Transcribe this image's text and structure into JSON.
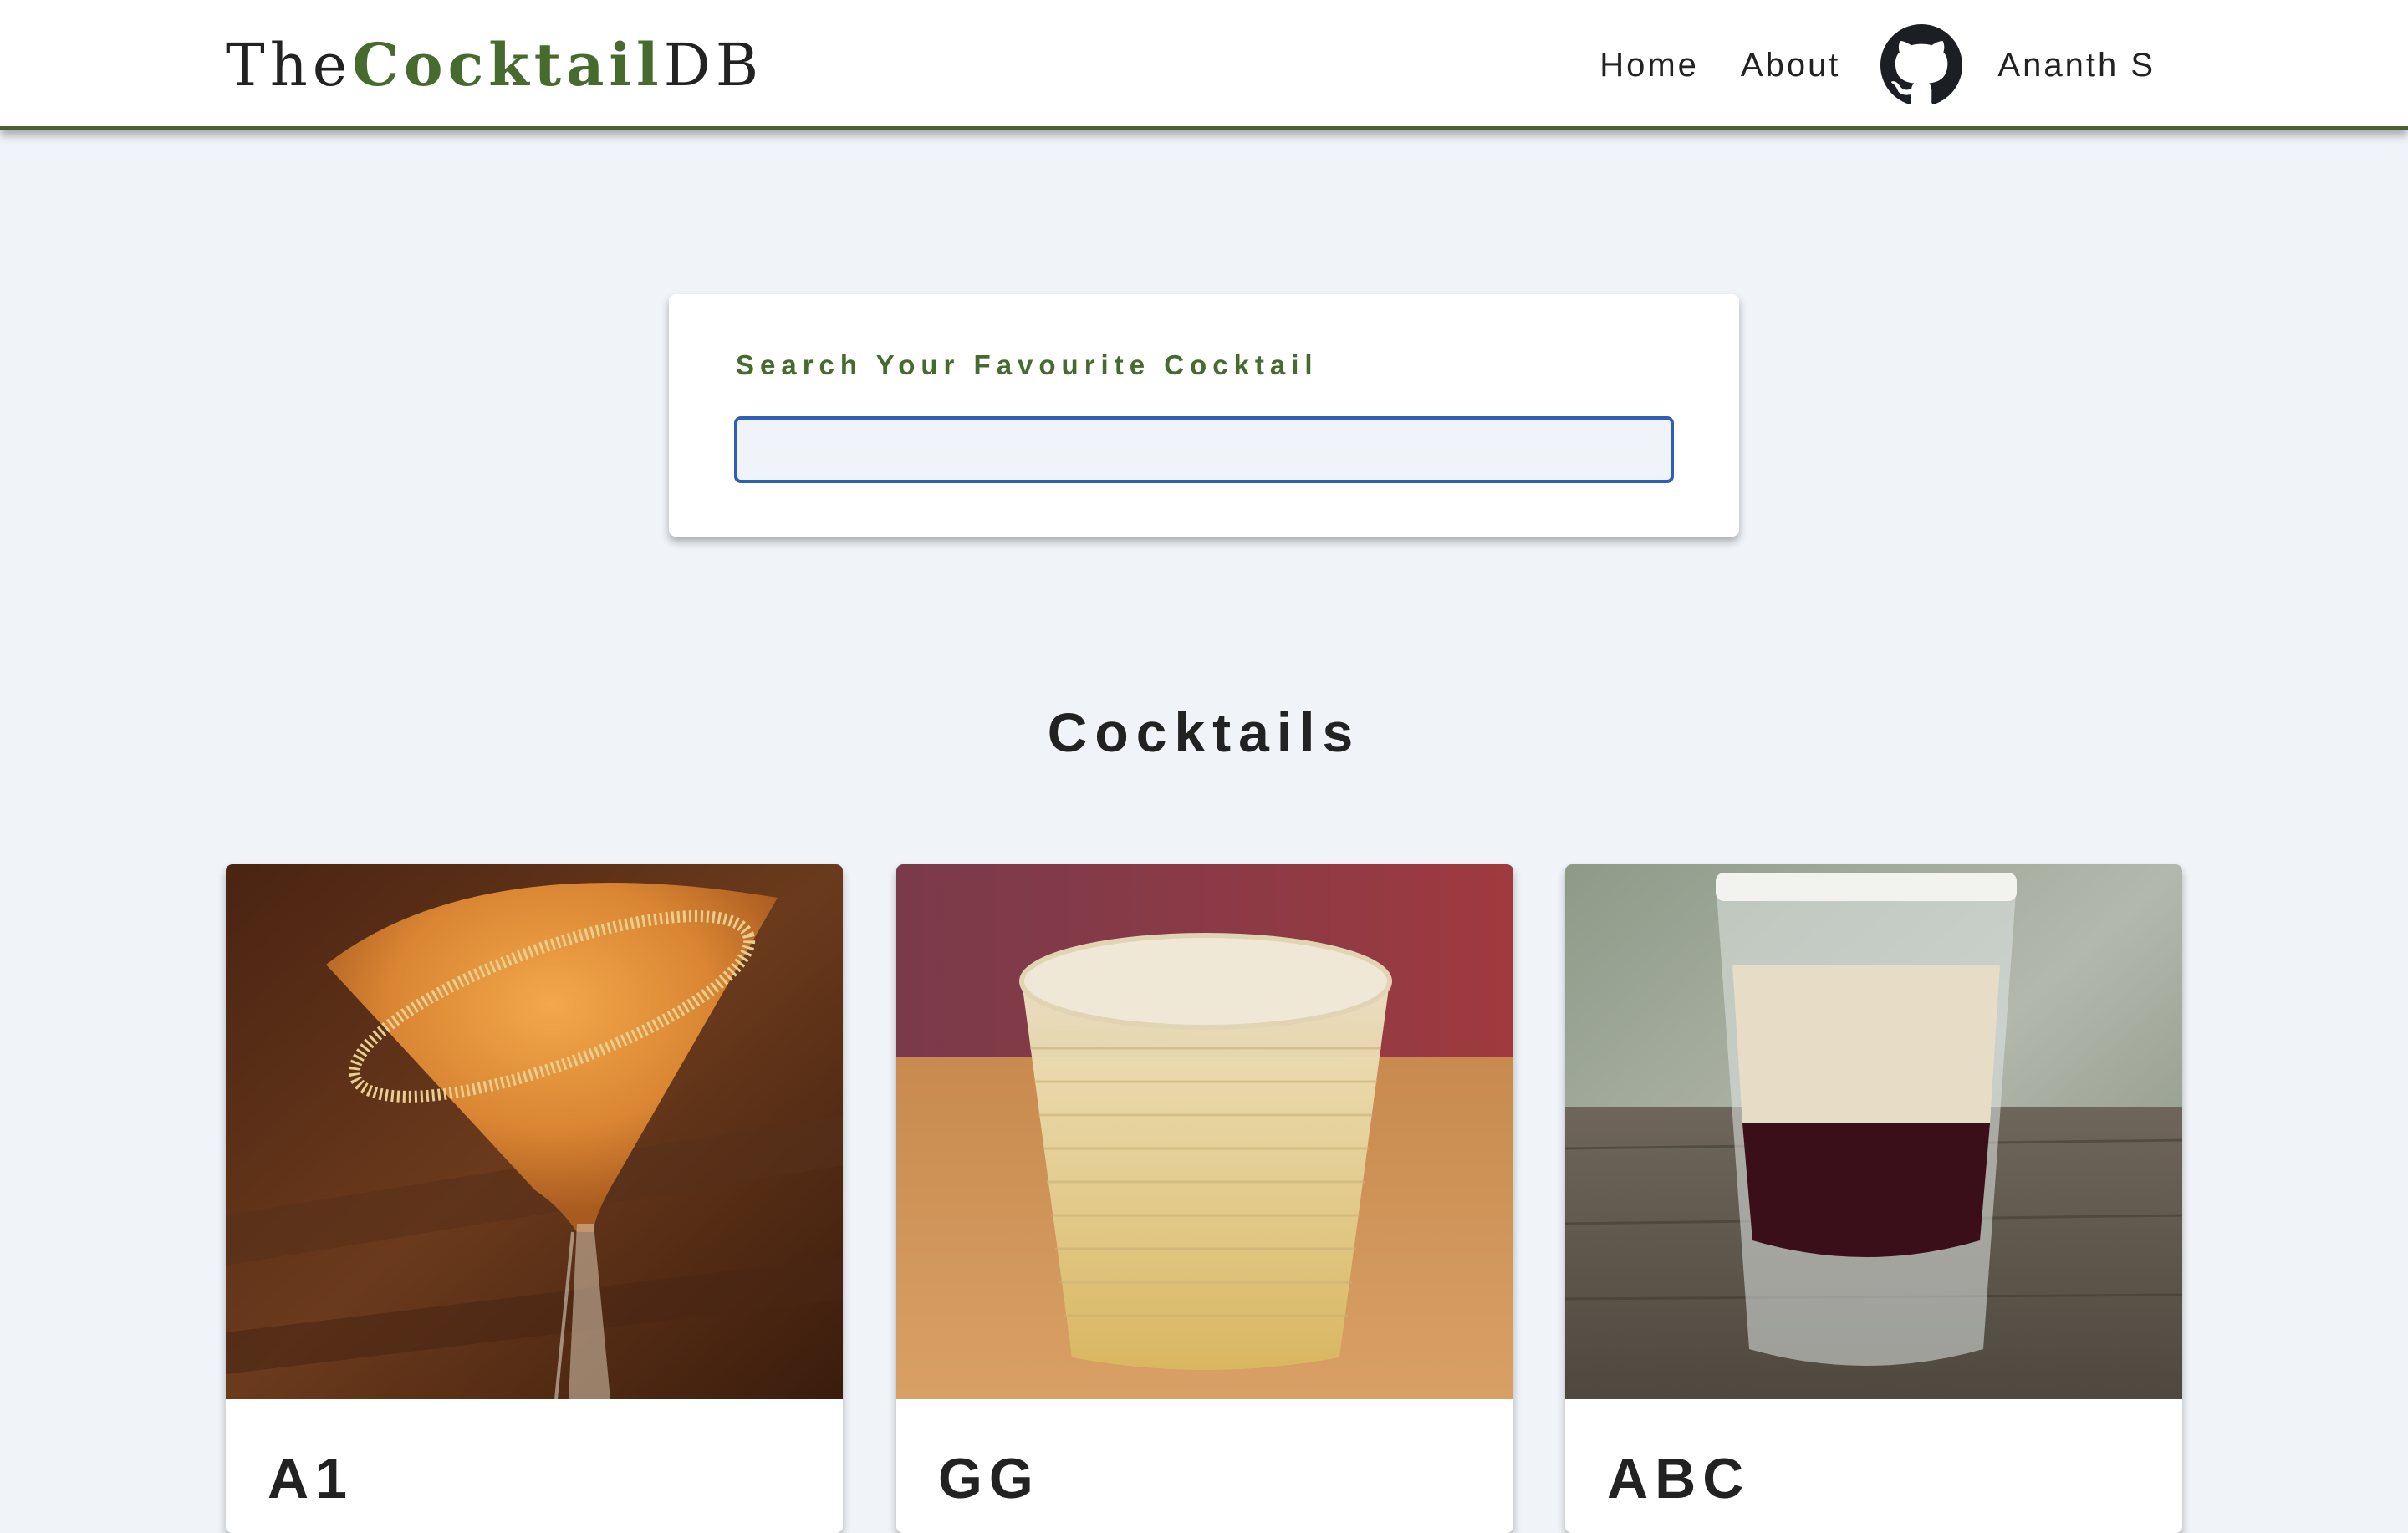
{
  "brand": {
    "prefix": "The",
    "accent": "Cocktail",
    "suffix": "DB"
  },
  "nav": {
    "home_label": "Home",
    "about_label": "About",
    "github_icon": "github-icon",
    "user_name": "Ananth S"
  },
  "search": {
    "label": "Search Your Favourite Cocktail",
    "value": "",
    "placeholder": ""
  },
  "cocktails": {
    "title": "Cocktails",
    "items": [
      {
        "name": "A1"
      },
      {
        "name": "GG"
      },
      {
        "name": "ABC"
      }
    ]
  },
  "colors": {
    "accent_green": "#476b2f",
    "navbar_border": "#4a6033",
    "page_background": "#f0f4f8",
    "input_border": "#2d5fb8"
  }
}
